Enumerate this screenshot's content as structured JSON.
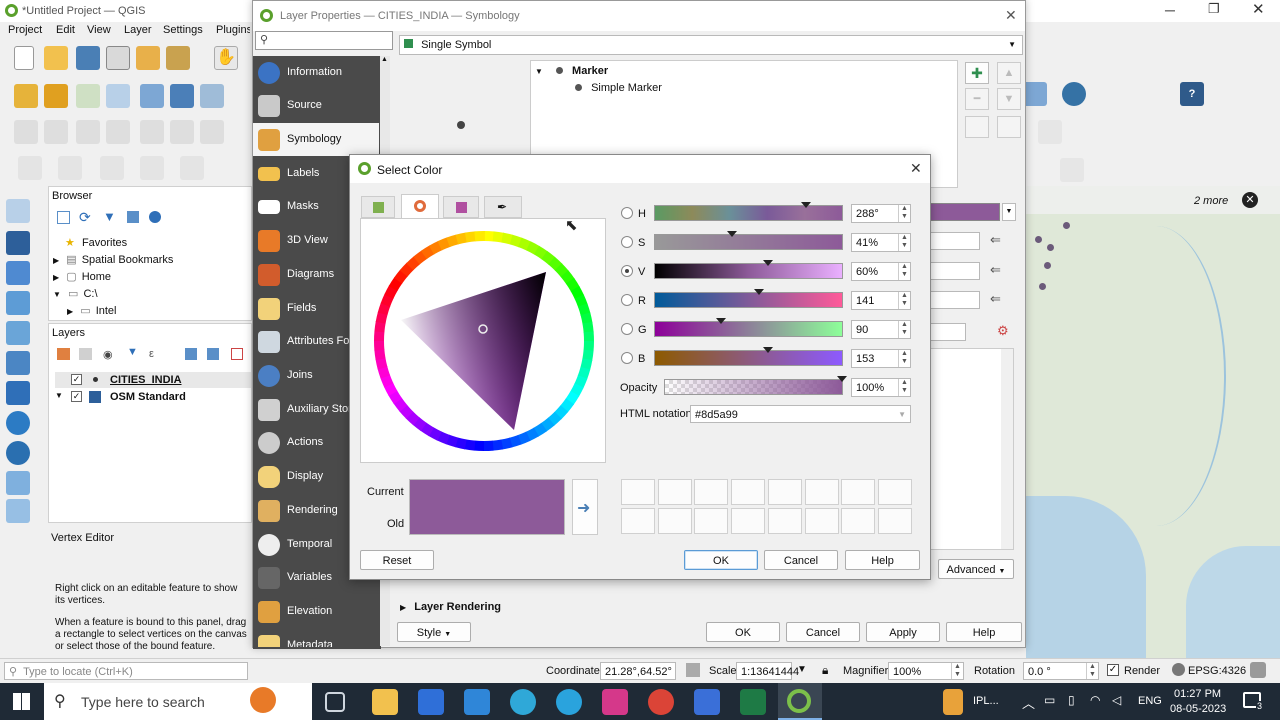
{
  "main_window": {
    "title": "*Untitled Project — QGIS",
    "menu": [
      "Project",
      "Edit",
      "View",
      "Layer",
      "Settings",
      "Plugins"
    ]
  },
  "browser": {
    "title": "Browser",
    "items": [
      "Favorites",
      "Spatial Bookmarks",
      "Home",
      "C:\\",
      "Intel"
    ]
  },
  "layers": {
    "title": "Layers",
    "items": [
      "CITIES_INDIA",
      "OSM Standard"
    ]
  },
  "vertex": {
    "title": "Vertex Editor",
    "text1": "Right click on an editable feature to show its vertices.",
    "text2": "When a feature is bound to this panel, drag a rectangle to select vertices on the canvas or select those of the bound feature."
  },
  "map": {
    "more_label": "2 more"
  },
  "layer_props": {
    "title": "Layer Properties — CITIES_INDIA — Symbology",
    "nav": [
      "Information",
      "Source",
      "Symbology",
      "Labels",
      "Masks",
      "3D View",
      "Diagrams",
      "Fields",
      "Attributes Form",
      "Joins",
      "Auxiliary Storage",
      "Actions",
      "Display",
      "Rendering",
      "Temporal",
      "Variables",
      "Elevation",
      "Metadata"
    ],
    "renderer": "Single Symbol",
    "tree_root": "Marker",
    "tree_child": "Simple Marker",
    "advanced": "Advanced",
    "layer_rendering": "Layer Rendering",
    "style": "Style",
    "ok": "OK",
    "cancel": "Cancel",
    "apply": "Apply",
    "help": "Help"
  },
  "select_color": {
    "title": "Select Color",
    "channels": [
      {
        "key": "H",
        "value": "288°",
        "fraction": 0.8
      },
      {
        "key": "S",
        "value": "41%",
        "fraction": 0.41
      },
      {
        "key": "V",
        "value": "60%",
        "fraction": 0.6
      },
      {
        "key": "R",
        "value": "141",
        "fraction": 0.55
      },
      {
        "key": "G",
        "value": "90",
        "fraction": 0.35
      },
      {
        "key": "B",
        "value": "153",
        "fraction": 0.6
      }
    ],
    "opacity_label": "Opacity",
    "opacity_value": "100%",
    "html_label": "HTML notation",
    "html_value": "#8d5a99",
    "current_label": "Current",
    "old_label": "Old",
    "current_color": "#8d5a99",
    "reset": "Reset",
    "ok": "OK",
    "cancel": "Cancel",
    "help": "Help"
  },
  "statusbar": {
    "locate_placeholder": "Type to locate (Ctrl+K)",
    "coordinate_label": "Coordinate",
    "coordinate_value": "21.28°,64.52°",
    "scale_label": "Scale",
    "scale_value": "1:13641444",
    "magnifier_label": "Magnifier",
    "magnifier_value": "100%",
    "rotation_label": "Rotation",
    "rotation_value": "0.0 °",
    "render_label": "Render",
    "crs": "EPSG:4326"
  },
  "taskbar": {
    "search_placeholder": "Type here to search",
    "tray_text": "IPL...",
    "lang": "ENG",
    "time": "01:27 PM",
    "date": "08-05-2023",
    "notifications": "3"
  }
}
